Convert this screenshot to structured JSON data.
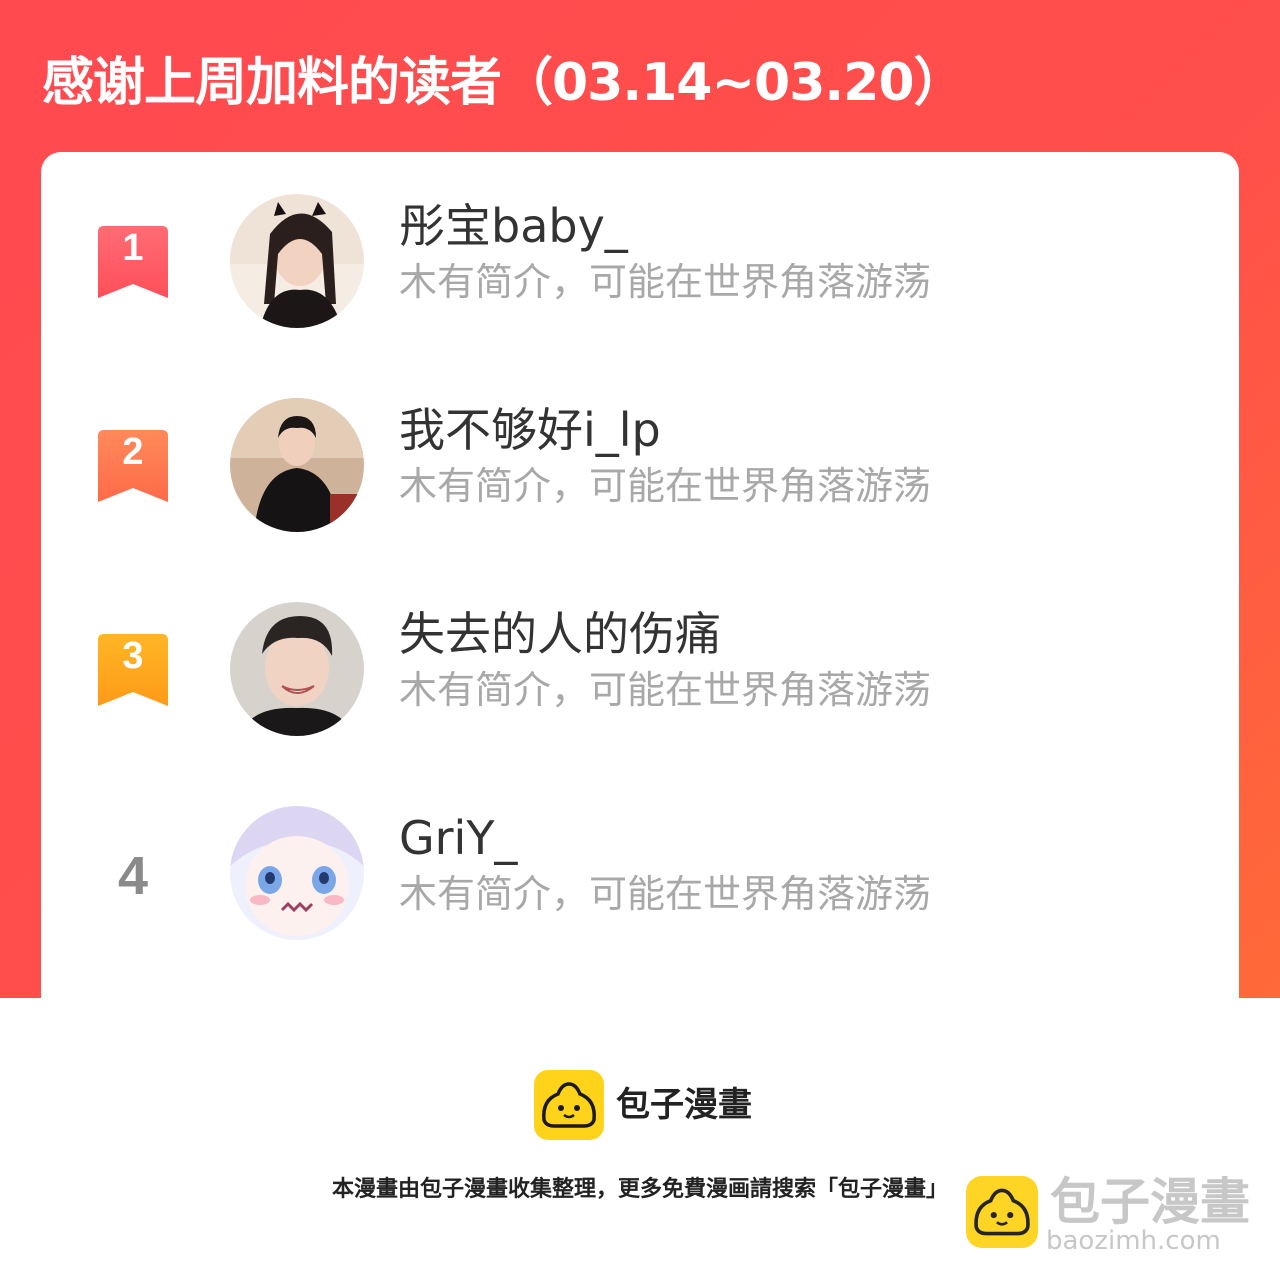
{
  "header": {
    "title": "感谢上周加料的读者（03.14~03.20）"
  },
  "readers": [
    {
      "rank": "1",
      "name": "彤宝baby_",
      "bio": "木有简介，可能在世界角落游荡"
    },
    {
      "rank": "2",
      "name": "我不够好i_lp",
      "bio": "木有简介，可能在世界角落游荡"
    },
    {
      "rank": "3",
      "name": "失去的人的伤痛",
      "bio": "木有简介，可能在世界角落游荡"
    },
    {
      "rank": "4",
      "name": "GriY_",
      "bio": "木有简介，可能在世界角落游荡"
    }
  ],
  "footer": {
    "brand": "包子漫畫",
    "note": "本漫畫由包子漫畫收集整理，更多免費漫画請搜索「包子漫畫」"
  },
  "watermark": {
    "title": "包子漫畫",
    "url": "baozimh.com"
  },
  "colors": {
    "banner": "#ff4a50",
    "rank1": "#ff5a64",
    "rank2": "#ff7a4a",
    "rank3": "#ffa51e",
    "brand_yellow": "#ffd31a"
  }
}
